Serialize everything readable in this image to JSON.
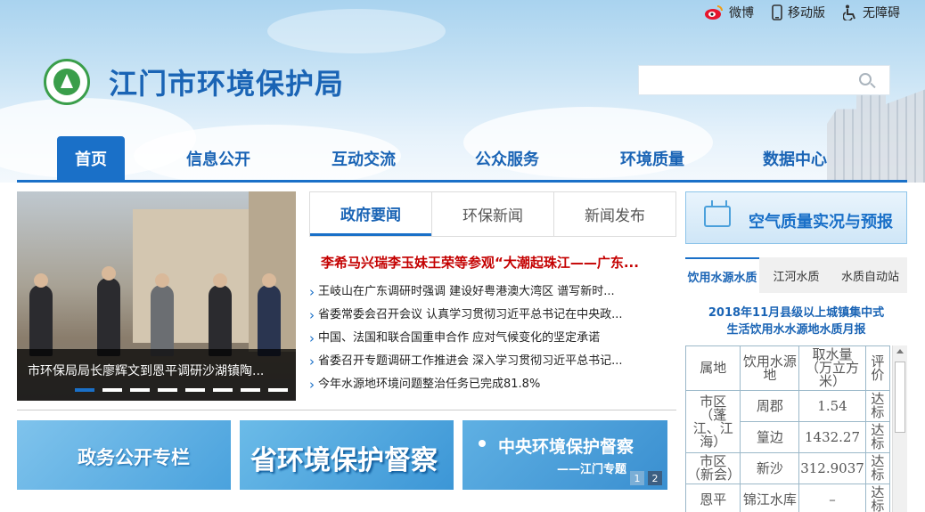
{
  "topbar": {
    "weibo": "微博",
    "mobile": "移动版",
    "accessible": "无障碍"
  },
  "header": {
    "title": "江门市环境保护局",
    "search_placeholder": ""
  },
  "nav": [
    "首页",
    "信息公开",
    "互动交流",
    "公众服务",
    "环境质量",
    "数据中心"
  ],
  "slider": {
    "caption": "市环保局局长廖辉文到恩平调研沙湖镇陶..."
  },
  "news": {
    "tabs": [
      "政府要闻",
      "环保新闻",
      "新闻发布"
    ],
    "headline": "李希马兴瑞李玉妹王荣等参观“大潮起珠江——广东...",
    "items": [
      "王岐山在广东调研时强调 建设好粤港澳大湾区 谱写新时...",
      "省委常委会召开会议 认真学习贯彻习近平总书记在中央政...",
      "中国、法国和联合国重申合作 应对气候变化的坚定承诺",
      "省委召开专题调研工作推进会 深入学习贯彻习近平总书记...",
      "今年水源地环境问题整治任务已完成81.8%"
    ]
  },
  "air": {
    "label": "空气质量实况与预报"
  },
  "water": {
    "tabs": [
      "饮用水源水质",
      "江河水质",
      "水质自动站"
    ],
    "title_line1": "2018年11月县级以上城镇集中式",
    "title_line2": "生活饮用水水源地水质月报",
    "headers": [
      "属地",
      "饮用水源地",
      "取水量（万立方米）",
      "评价"
    ],
    "rows": [
      {
        "area": "市区（蓬江、江海）",
        "source": "周郡",
        "volume": "1.54",
        "eval": "达标"
      },
      {
        "area": "",
        "source": "篁边",
        "volume": "1432.27",
        "eval": "达标"
      },
      {
        "area": "市区（新会）",
        "source": "新沙",
        "volume": "312.9037",
        "eval": "达标"
      },
      {
        "area": "恩平",
        "source": "锦江水库",
        "volume": "–",
        "eval": "达标"
      }
    ]
  },
  "banners": {
    "b1": "政务公开专栏",
    "b2": "省环境保护督察",
    "b3_title": "中央环境保护督察",
    "b3_sub": "——江门专题",
    "pages": [
      "1",
      "2"
    ]
  }
}
